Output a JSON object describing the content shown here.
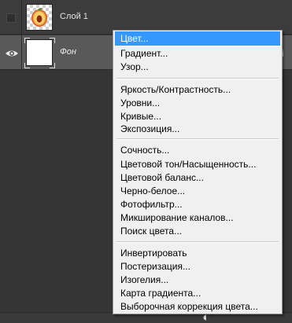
{
  "layers": [
    {
      "name": "Слой 1",
      "visible": false,
      "selected": false
    },
    {
      "name": "Фон",
      "visible": true,
      "selected": true,
      "locked": true
    }
  ],
  "menu": {
    "groups": [
      [
        "Цвет...",
        "Градиент...",
        "Узор..."
      ],
      [
        "Яркость/Контрастность...",
        "Уровни...",
        "Кривые...",
        "Экспозиция..."
      ],
      [
        "Сочность...",
        "Цветовой тон/Насыщенность...",
        "Цветовой баланс...",
        "Черно-белое...",
        "Фотофильтр...",
        "Микширование каналов...",
        "Поиск цвета..."
      ],
      [
        "Инвертировать",
        "Постеризация...",
        "Изогелия...",
        "Карта градиента...",
        "Выборочная коррекция цвета..."
      ]
    ],
    "highlighted": "Цвет..."
  },
  "colors": {
    "highlight": "#3399ff",
    "menu_bg": "#f0f0f0",
    "panel_bg": "#353535",
    "selected_layer_bg": "#595959"
  }
}
